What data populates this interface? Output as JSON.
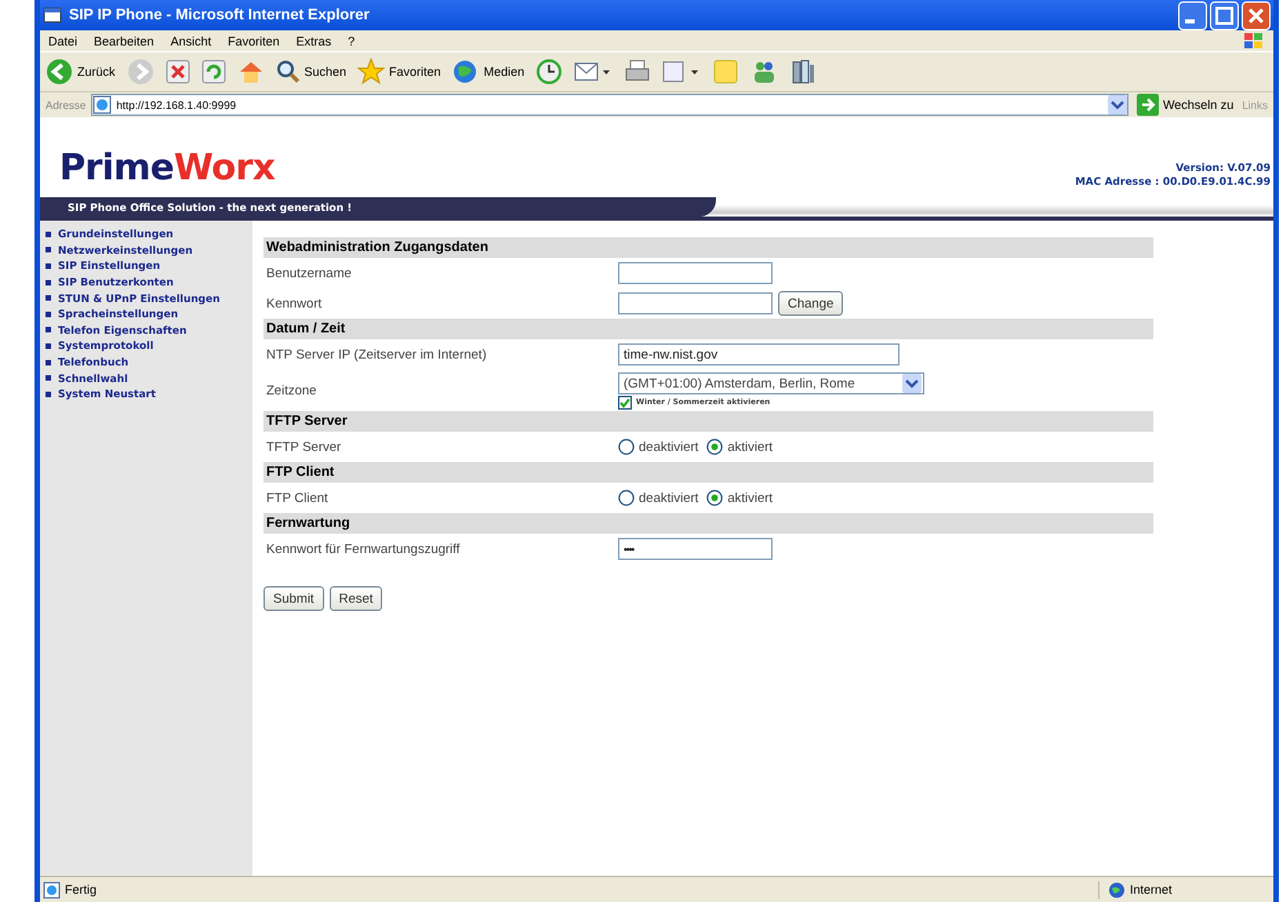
{
  "window": {
    "title": "SIP IP Phone - Microsoft Internet Explorer"
  },
  "menu": [
    "Datei",
    "Bearbeiten",
    "Ansicht",
    "Favoriten",
    "Extras",
    "?"
  ],
  "toolbar": {
    "back": "Zurück",
    "search": "Suchen",
    "favorites": "Favoriten",
    "media": "Medien"
  },
  "address": {
    "label": "Adresse",
    "url": "http://192.168.1.40:9999",
    "go": "Wechseln zu",
    "links": "Links"
  },
  "header": {
    "logo_a": "Prime",
    "logo_b": "Worx",
    "version": "Version: V.07.09",
    "mac": "MAC Adresse : 00.D0.E9.01.4C.99",
    "tagline": "SIP Phone Office Solution - the next generation !"
  },
  "sidebar": {
    "items": [
      "Grundeinstellungen",
      "Netzwerkeinstellungen",
      "SIP Einstellungen",
      "SIP Benutzerkonten",
      "STUN & UPnP Einstellungen",
      "Spracheinstellungen",
      "Telefon Eigenschaften",
      "Systemprotokoll",
      "Telefonbuch",
      "Schnellwahl",
      "System Neustart"
    ]
  },
  "sections": [
    {
      "title": "Webadministration Zugangsdaten",
      "rows": [
        {
          "kind": "text",
          "label": "Benutzername",
          "value": "",
          "wide": false
        },
        {
          "kind": "password_button",
          "label": "Kennwort",
          "value": "",
          "button": "Change"
        }
      ]
    },
    {
      "title": "Datum / Zeit",
      "rows": [
        {
          "kind": "text",
          "label": "NTP Server IP (Zeitserver im Internet)",
          "value": "time-nw.nist.gov",
          "wide": true
        },
        {
          "kind": "select",
          "label": "Zeitzone",
          "value": "(GMT+01:00) Amsterdam, Berlin, Rome",
          "checkbox": {
            "label": "Winter / Sommerzeit aktivieren",
            "checked": true
          }
        }
      ]
    },
    {
      "title": "TFTP Server",
      "rows": [
        {
          "kind": "radio",
          "label": "TFTP Server",
          "options": [
            {
              "label": "deaktiviert",
              "selected": false
            },
            {
              "label": "aktiviert",
              "selected": true
            }
          ]
        }
      ]
    },
    {
      "title": "FTP Client",
      "rows": [
        {
          "kind": "radio",
          "label": "FTP Client",
          "options": [
            {
              "label": "deaktiviert",
              "selected": false
            },
            {
              "label": "aktiviert",
              "selected": true
            }
          ]
        }
      ]
    },
    {
      "title": "Fernwartung",
      "rows": [
        {
          "kind": "password",
          "label": "Kennwort für Fernwartungszugriff",
          "value": "••••"
        }
      ]
    }
  ],
  "buttons": [
    "Submit",
    "Reset"
  ],
  "status_bar": {
    "left": "Fertig",
    "zone": "Internet"
  }
}
